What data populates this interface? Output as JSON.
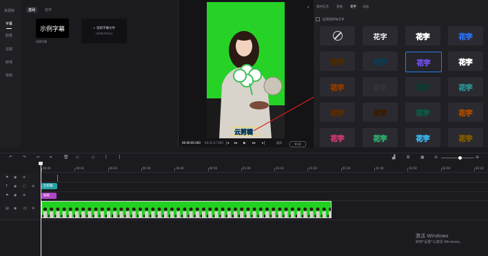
{
  "leftnav": {
    "top": "资源库",
    "items": [
      {
        "label": "字幕",
        "active": true
      },
      {
        "label": "贴纸",
        "active": false
      },
      {
        "label": "滤镜",
        "active": false
      },
      {
        "label": "转场",
        "active": false
      },
      {
        "label": "特效",
        "active": false
      }
    ]
  },
  "resource": {
    "tabs": [
      {
        "label": "基础",
        "active": true
      },
      {
        "label": "花字",
        "active": false
      }
    ],
    "template_text": "示例字幕",
    "template_label": "创建字幕",
    "import_line1": "+ 提取字幕文件",
    "import_line2": "(支持srt/ass)"
  },
  "preview": {
    "subtitle_text": "云剪辑",
    "time_current": "00:00:00.000",
    "time_total": "00:02:27.800",
    "fullscreen_label": "画质",
    "ratio_label": "9:16"
  },
  "rightpanel": {
    "tabs": [
      {
        "label": "素材信息",
        "active": false
      },
      {
        "label": "基础",
        "active": false
      },
      {
        "label": "花字",
        "active": true
      },
      {
        "label": "动画",
        "active": false
      }
    ],
    "apply_all": "应用到所有文字",
    "cell_text": "花字",
    "styles": [
      {
        "color": "#ffffff",
        "stroke": "none",
        "bg": "none"
      },
      {
        "color": "#ff5a8a",
        "stroke": "#ffffff",
        "bg": "none"
      },
      {
        "color": "#ffffff",
        "stroke": "#2b6be6",
        "bg": "none"
      },
      {
        "color": "#ffb02e",
        "stroke": "#4a2a00",
        "bg": "none"
      },
      {
        "color": "#7be3ff",
        "stroke": "#0a3b55",
        "bg": "none"
      },
      {
        "color": "#ffffff",
        "stroke": "#6a4bd6",
        "bg": "none"
      },
      {
        "color": "#ff6262",
        "stroke": "#ffffff",
        "bg": "none"
      },
      {
        "color": "#ffcf3a",
        "stroke": "#8a3a00",
        "bg": "none"
      },
      {
        "color": "#ffffff",
        "stroke": "#333333",
        "bg": "none"
      },
      {
        "color": "#2fe0b8",
        "stroke": "#0a3a30",
        "bg": "none"
      },
      {
        "color": "#ffffff",
        "stroke": "#2d8a8a",
        "bg": "none"
      },
      {
        "color": "#ffa53a",
        "stroke": "#5a2a00",
        "bg": "none"
      },
      {
        "color": "#ff9b4a",
        "stroke": "#3a1a00",
        "bg": "none"
      },
      {
        "color": "#7fffd0",
        "stroke": "#0b5a40",
        "bg": "none"
      },
      {
        "color": "#ffd23a",
        "stroke": "#a04a00",
        "bg": "none"
      },
      {
        "color": "#ffffff",
        "stroke": "#c43a6a",
        "bg": "none"
      },
      {
        "color": "#e8fff2",
        "stroke": "#2aa86a",
        "bg": "none"
      },
      {
        "color": "#ffffff",
        "stroke": "#3ab0e6",
        "bg": "none"
      },
      {
        "color": "#ffe27a",
        "stroke": "#7a5a00",
        "bg": "none"
      },
      {
        "color": "#ffffff",
        "stroke": "#000000",
        "bg": "none"
      }
    ],
    "selected_index": 5
  },
  "timeline": {
    "ruler": [
      "00:00",
      "00:10",
      "00:20",
      "00:30",
      "00:40",
      "00:50",
      "01:00",
      "01:10",
      "01:20",
      "01:30",
      "01:40",
      "01:50",
      "02:00",
      "02:10"
    ],
    "subtitle_clip": "云剪辑",
    "style_clip": "贴纸"
  },
  "watermark": {
    "line1": "激活 Windows",
    "line2": "转到\"设置\"以激活 Windows。"
  },
  "colors": {
    "accent": "#2b7de9",
    "green_screen": "#27d227",
    "subtitle_clip": "#2aa1a6",
    "sticker_clip": "#b046c9"
  }
}
